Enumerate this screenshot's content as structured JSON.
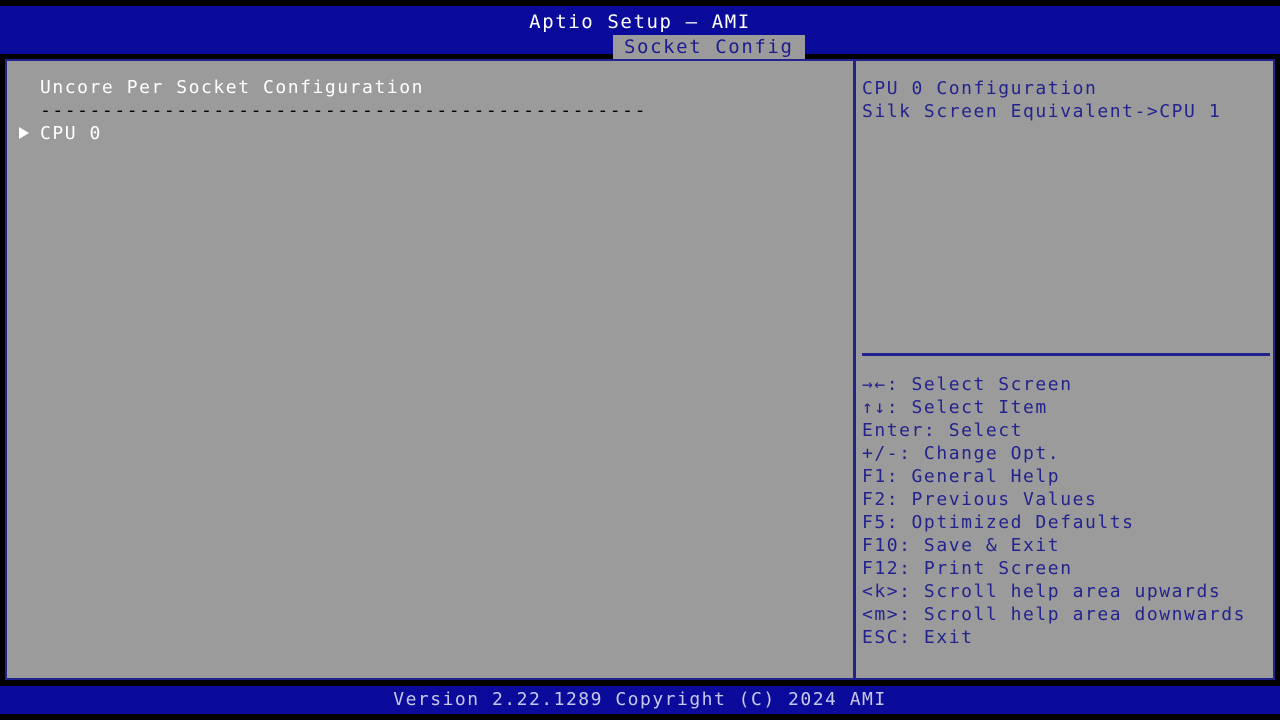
{
  "colors": {
    "bar_blue": "#0b0b9b",
    "border_blue": "#23238e",
    "pane_gray": "#9b9b9b",
    "text_white": "#ffffff",
    "text_blue": "#23238e",
    "black": "#000000"
  },
  "header": {
    "app_title": "Aptio Setup – AMI",
    "active_tab": "Socket Config"
  },
  "settings": {
    "section_title": "Uncore Per Socket Configuration",
    "separator": "-------------------------------------------------",
    "items": [
      {
        "label": "CPU 0",
        "marker": "submenu-arrow-icon"
      }
    ]
  },
  "help": {
    "lines": [
      "CPU 0 Configuration",
      "Silk Screen Equivalent->CPU 1"
    ]
  },
  "legend": {
    "lines": [
      "→←: Select Screen",
      "↑↓: Select Item",
      "Enter: Select",
      "+/-: Change Opt.",
      "F1: General Help",
      "F2: Previous Values",
      "F5: Optimized Defaults",
      "F10: Save & Exit",
      "F12: Print Screen",
      "<k>: Scroll help area upwards",
      "<m>: Scroll help area downwards",
      "ESC: Exit"
    ]
  },
  "footer": {
    "version_text": "Version 2.22.1289 Copyright (C) 2024 AMI"
  }
}
